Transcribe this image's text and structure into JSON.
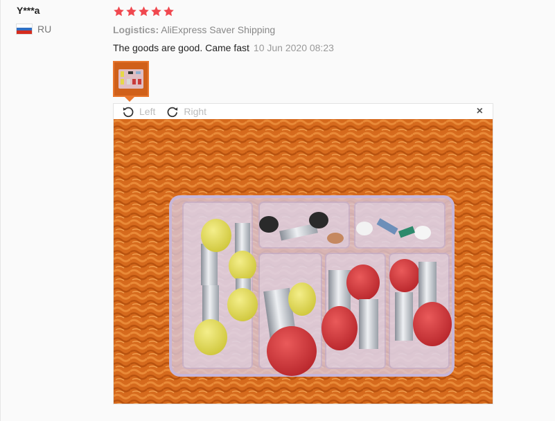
{
  "review": {
    "user_name": "Y***a",
    "country_code": "RU",
    "rating": 5,
    "logistics_label": "Logistics:",
    "logistics_value": "AliExpress Saver Shipping",
    "feedback_text": "The goods are good. Came fast",
    "feedback_date": "10 Jun 2020 08:23"
  },
  "viewer": {
    "rotate_left_label": "Left",
    "rotate_right_label": "Right",
    "close_label": "×"
  },
  "icons": {
    "star": "star-icon",
    "flag": "russia-flag-icon",
    "rotate_left": "rotate-left-icon",
    "rotate_right": "rotate-right-icon",
    "close": "close-icon"
  },
  "colors": {
    "star": "#f0484f",
    "thumb_border": "#e8772e",
    "carpet": "#d86a1d"
  }
}
